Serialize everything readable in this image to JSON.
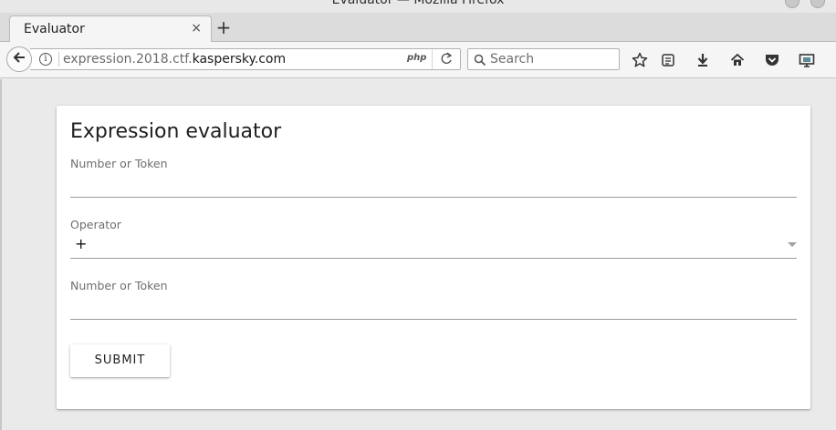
{
  "window": {
    "title": "Evaluator — Mozilla Firefox"
  },
  "tabs": [
    {
      "title": "Evaluator",
      "close_glyph": "×",
      "active": true
    }
  ],
  "new_tab_glyph": "+",
  "navbar": {
    "url_prefix": "expression.2018.ctf.",
    "url_host": "kaspersky.com",
    "php_badge": "php",
    "search_placeholder": "Search",
    "icons": [
      "back-arrow-icon",
      "info-icon",
      "php-icon",
      "reload-icon",
      "search-icon",
      "bookmark-star-icon",
      "reading-list-icon",
      "downloads-icon",
      "home-icon",
      "pocket-icon",
      "developer-icon"
    ]
  },
  "form": {
    "heading": "Expression evaluator",
    "field1_label": "Number or Token",
    "field1_value": "",
    "operator_label": "Operator",
    "operator_value": "+",
    "field2_label": "Number or Token",
    "field2_value": "",
    "submit_label": "SUBMIT"
  }
}
